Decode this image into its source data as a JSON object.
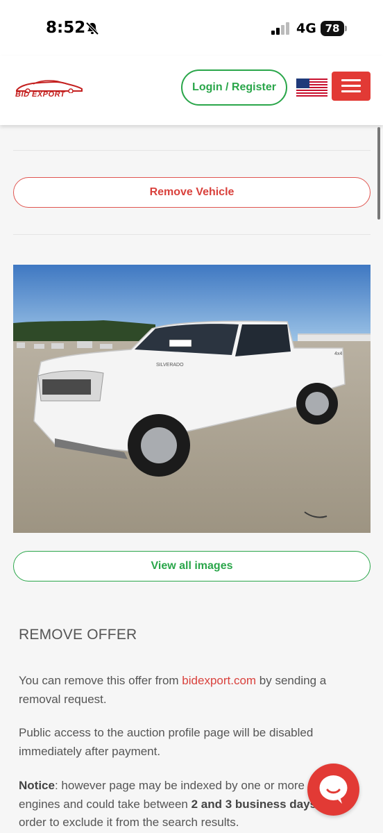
{
  "status_bar": {
    "time": "8:52",
    "network": "4G",
    "battery": "78"
  },
  "header": {
    "logo_text": "BID EXPORT",
    "login_label": "Login / Register",
    "language_icon": "us-flag-icon",
    "menu_icon": "hamburger-icon"
  },
  "actions": {
    "remove_vehicle_label": "Remove Vehicle",
    "view_images_label": "View all images"
  },
  "vehicle": {
    "photo_badge": "SILVERADO",
    "photo_badge_2": "4x4"
  },
  "remove_offer": {
    "title": "REMOVE OFFER",
    "p1_prefix": "You can remove this offer from ",
    "p1_link": "bidexport.com",
    "p1_suffix": " by sending a removal request.",
    "p2": "Public access to the auction profile page will be disabled immediately after payment.",
    "p3_notice": "Notice",
    "p3_a": ": however page may be indexed by one or more search engines and could take between ",
    "p3_strong": "2 and 3 business days",
    "p3_b": " in order to exclude it from the search results."
  },
  "colors": {
    "accent_red": "#e23a35",
    "accent_green": "#2aa64a",
    "background": "#f6f6f6"
  },
  "chat": {
    "icon": "chat-bubble-icon"
  }
}
